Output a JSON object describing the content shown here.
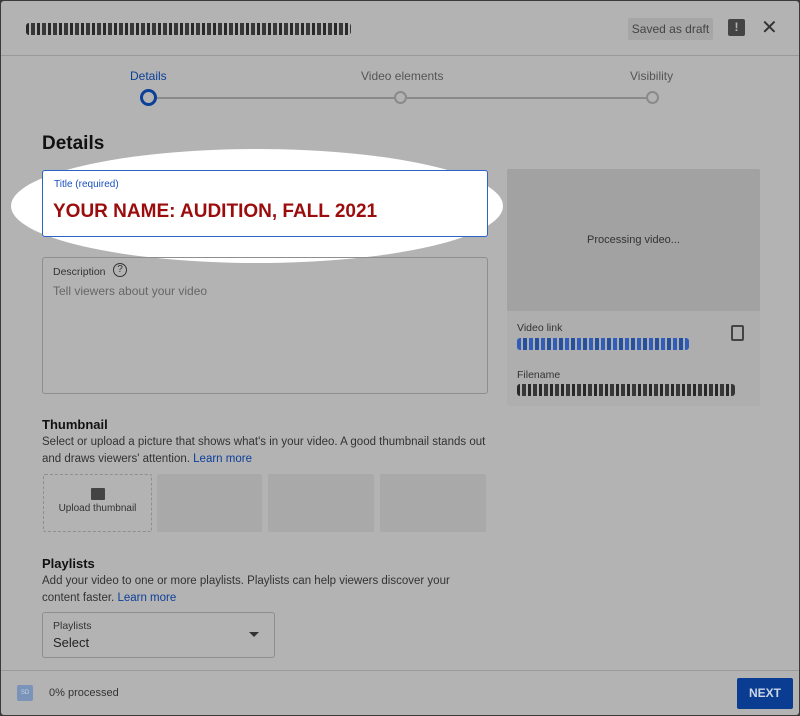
{
  "header": {
    "saved_label": "Saved as draft",
    "feedback_icon": "feedback-icon",
    "close_icon": "close-icon"
  },
  "steps": [
    {
      "label": "Details",
      "active": true
    },
    {
      "label": "Video elements",
      "active": false
    },
    {
      "label": "Visibility",
      "active": false
    }
  ],
  "details": {
    "heading": "Details",
    "title_label": "Title (required)",
    "title_value": "YOUR NAME: AUDITION, FALL 2021",
    "description_label": "Description",
    "description_placeholder": "Tell viewers about your video"
  },
  "thumbnail": {
    "heading": "Thumbnail",
    "text": "Select or upload a picture that shows what's in your video. A good thumbnail stands out and draws viewers' attention.",
    "link": "Learn more",
    "upload_label": "Upload thumbnail"
  },
  "playlists": {
    "heading": "Playlists",
    "text": "Add your video to one or more playlists. Playlists can help viewers discover your content faster.",
    "link": "Learn more",
    "select_label": "Playlists",
    "select_value": "Select"
  },
  "preview": {
    "status": "Processing video...",
    "video_link_label": "Video link",
    "filename_label": "Filename"
  },
  "footer": {
    "badge": "SD",
    "status": "0% processed",
    "next_label": "NEXT"
  },
  "colors": {
    "accent": "#0a3d91",
    "title_text": "#9b0d0d"
  }
}
